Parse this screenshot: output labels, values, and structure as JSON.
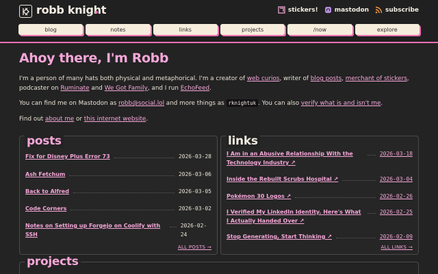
{
  "site": {
    "title": "robb knight",
    "accent": "#f06fb5"
  },
  "toplinks": [
    {
      "label": "stickers!",
      "icon": "sticker-icon"
    },
    {
      "label": "mastodon",
      "icon": "mastodon-icon"
    },
    {
      "label": "subscribe",
      "icon": "rss-icon"
    }
  ],
  "nav": [
    "blog",
    "notes",
    "links",
    "projects",
    "/now",
    "explore"
  ],
  "hero": {
    "greeting": "Ahoy there, I'm Robb"
  },
  "intro": {
    "p1_a": "I'm a person of many hats both physical and metaphorical. I'm a creator of ",
    "p1_web_curios": "web curios",
    "p1_b": ", writer of ",
    "p1_blog_posts": "blog posts",
    "p1_c": ", ",
    "p1_stickers": "merchant of stickers",
    "p1_d": ", podcaster on ",
    "p1_ruminate": "Ruminate",
    "p1_e": " and ",
    "p1_wegotfamily": "We Got Family",
    "p1_f": ", and I run ",
    "p1_echofeed": "EchoFeed",
    "p1_g": ".",
    "p2_a": "You can find me on Mastodon as ",
    "p2_handle": "robb@social.lol",
    "p2_b": " and more things as ",
    "p2_code": "rknightuk",
    "p2_c": ". You can also ",
    "p2_verify": "verify what is and isn't me",
    "p2_d": ".",
    "p3_a": "Find out ",
    "p3_about": "about me",
    "p3_b": " or ",
    "p3_site": "this internet website",
    "p3_c": "."
  },
  "posts": {
    "title": "posts",
    "more": "ALL POSTS →",
    "items": [
      {
        "title": "Fix for Disney Plus Error 73",
        "date": "2026-03-28"
      },
      {
        "title": "Ash Fetchum",
        "date": "2026-03-06"
      },
      {
        "title": "Back to Alfred",
        "date": "2026-03-05"
      },
      {
        "title": "Code Corners",
        "date": "2026-03-02"
      },
      {
        "title": "Notes on Setting up Forgejo on Coolify with SSH",
        "date": "2026-02-24"
      }
    ]
  },
  "links": {
    "title": "links",
    "more": "ALL LINKS →",
    "items": [
      {
        "title": "I Am in an Abusive Relationship With the Technology Industry ↗",
        "date": "2026-03-18"
      },
      {
        "title": "Inside the Rebuilt Scrubs Hospital ↗",
        "date": "2026-03-04"
      },
      {
        "title": "Pokémon 30 Logos ↗",
        "date": "2026-02-26"
      },
      {
        "title": "I Verified My LinkedIn Identity. Here's What I Actually Handed Over ↗",
        "date": "2026-02-25"
      },
      {
        "title": "Stop Generating, Start Thinking ↗",
        "date": "2026-02-09"
      }
    ]
  },
  "projects": {
    "title": "projects"
  }
}
